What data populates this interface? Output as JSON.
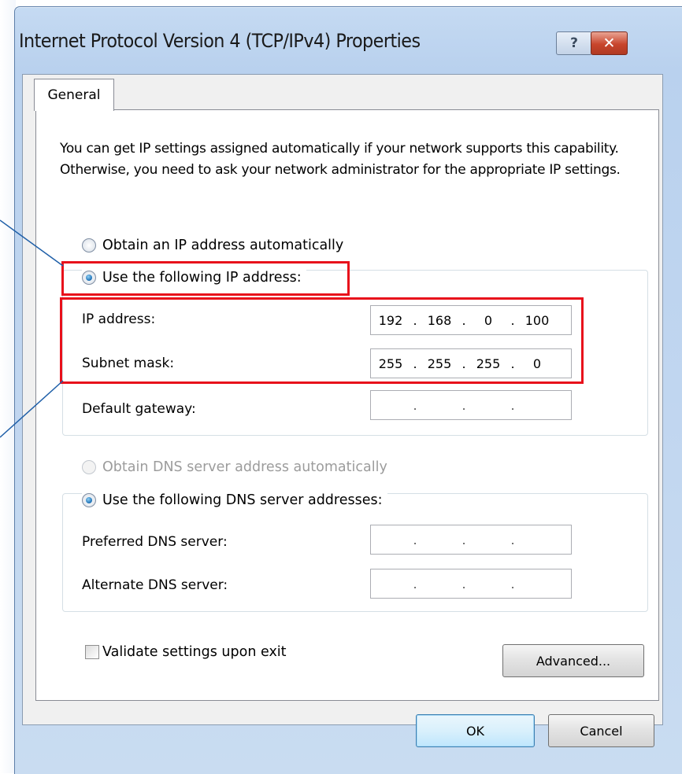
{
  "window": {
    "title": "Internet Protocol Version 4 (TCP/IPv4) Properties",
    "help_glyph": "?",
    "close_glyph": "✕"
  },
  "tabs": [
    {
      "label": "General"
    }
  ],
  "intro_text": "You can get IP settings assigned automatically if your network supports this capability. Otherwise, you need to ask your network administrator for the appropriate IP settings.",
  "ip_section": {
    "auto_option": {
      "label": "Obtain an IP address automatically",
      "selected": false
    },
    "manual_option": {
      "label": "Use the following IP address:",
      "selected": true
    },
    "fields": [
      {
        "label": "IP address:",
        "octets": [
          "192",
          "168",
          "0",
          "100"
        ]
      },
      {
        "label": "Subnet mask:",
        "octets": [
          "255",
          "255",
          "255",
          "0"
        ]
      },
      {
        "label": "Default gateway:",
        "octets": [
          "",
          "",
          "",
          ""
        ]
      }
    ]
  },
  "dns_section": {
    "auto_option": {
      "label": "Obtain DNS server address automatically",
      "selected": false,
      "disabled": true
    },
    "manual_option": {
      "label": "Use the following DNS server addresses:",
      "selected": true
    },
    "fields": [
      {
        "label": "Preferred DNS server:",
        "octets": [
          "",
          "",
          "",
          ""
        ]
      },
      {
        "label": "Alternate DNS server:",
        "octets": [
          "",
          "",
          "",
          ""
        ]
      }
    ]
  },
  "validate_checkbox": {
    "label": "Validate settings upon exit",
    "checked": false
  },
  "buttons": {
    "advanced": "Advanced...",
    "ok": "OK",
    "cancel": "Cancel"
  },
  "colors": {
    "highlight": "#e8101b",
    "annotation_line": "#1f5fa8",
    "window_frame": "#b9d1ee"
  }
}
